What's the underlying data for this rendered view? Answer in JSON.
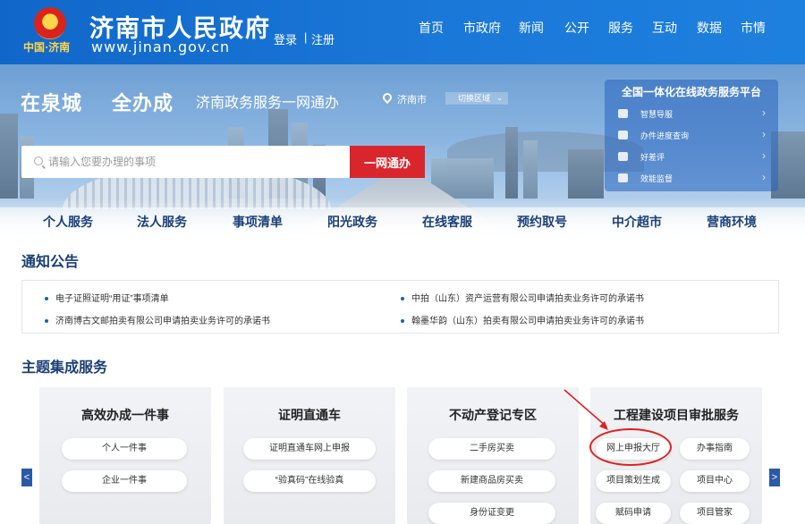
{
  "header": {
    "emblem_caption": "中国·济南",
    "site_name": "济南市人民政府",
    "site_url": "www.jinan.gov.cn",
    "login_label": "登录",
    "register_label": "注册",
    "nav": [
      "首页",
      "市政府",
      "新闻",
      "公开",
      "服务",
      "互动",
      "数据",
      "市情"
    ]
  },
  "banner": {
    "slogan_part1": "在泉城",
    "slogan_part2": "全办成",
    "slogan_sub": "济南政务服务一网通办",
    "location": "济南市",
    "switch_area_label": "切换区域",
    "search_placeholder": "请输入您要办理的事项",
    "search_button": "一网通办",
    "platform": {
      "title": "全国一体化在线政务服务平台",
      "items": [
        {
          "label": "智慧导服",
          "icon": "guide-icon"
        },
        {
          "label": "办件进度查询",
          "icon": "progress-icon"
        },
        {
          "label": "好差评",
          "icon": "review-icon"
        },
        {
          "label": "效能监督",
          "icon": "supervision-icon"
        }
      ]
    }
  },
  "main_nav": [
    "个人服务",
    "法人服务",
    "事项清单",
    "阳光政务",
    "在线客服",
    "预约取号",
    "中介超市",
    "营商环境"
  ],
  "notices": {
    "title": "通知公告",
    "items": [
      "电子证照证明“用证”事项清单",
      "中拍（山东）资产运营有限公司申请拍卖业务许可的承诺书",
      "济南博古文邮拍卖有限公司申请拍卖业务许可的承诺书",
      "翰墨华韵（山东）拍卖有限公司申请拍卖业务许可的承诺书"
    ]
  },
  "themes": {
    "title": "主题集成服务",
    "cards": [
      {
        "title": "高效办成一件事",
        "items": [
          "个人一件事",
          "企业一件事"
        ]
      },
      {
        "title": "证明直通车",
        "items": [
          "证明直通车网上申报",
          "“验真码”在线验真"
        ]
      },
      {
        "title": "不动产登记专区",
        "items": [
          "二手房买卖",
          "新建商品房买卖",
          "身份证变更"
        ]
      },
      {
        "title": "工程建设项目审批服务",
        "items": [
          "网上申报大厅",
          "办事指南",
          "项目策划生成",
          "项目中心",
          "赋码申请",
          "项目管家"
        ]
      }
    ],
    "prev_label": "<",
    "next_label": ">"
  },
  "colors": {
    "header_blue": "#1a78d8",
    "accent_red": "#d9262c",
    "title_navy": "#1a3f78",
    "highlight_red": "#e02020"
  }
}
